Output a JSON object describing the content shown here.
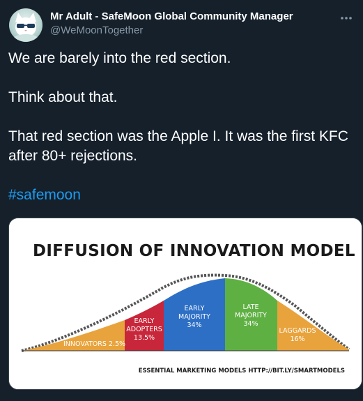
{
  "tweet": {
    "display_name": "Mr Adult - SafeMoon Global Community Manager",
    "handle": "@WeMoonTogether",
    "text_lines": [
      "We are barely into the red section.",
      "Think about that.",
      "That red section was the Apple I. It was the first KFC after 80+ rejections."
    ],
    "hashtag": "#safemoon",
    "more_icon": "more-horizontal-icon"
  },
  "media": {
    "title": "DIFFUSION OF INNOVATION MODEL",
    "footer": "ESSENTIAL MARKETING MODELS HTTP://BIT.LY/SMARTMODELS",
    "segments": [
      {
        "name": "innovators",
        "label_lines": [
          "INNOVATORS 2.5%"
        ],
        "color": "#e8a33c"
      },
      {
        "name": "early-adopters",
        "label_lines": [
          "EARLY",
          "ADOPTERS",
          "13.5%"
        ],
        "color": "#c8263a"
      },
      {
        "name": "early-majority",
        "label_lines": [
          "EARLY",
          "MAJORITY",
          "34%"
        ],
        "color": "#2c6fc5"
      },
      {
        "name": "late-majority",
        "label_lines": [
          "LATE",
          "MAJORITY",
          "34%"
        ],
        "color": "#5fb043"
      },
      {
        "name": "laggards",
        "label_lines": [
          "LAGGARDS",
          "16%"
        ],
        "color": "#e8a33c"
      }
    ]
  },
  "colors": {
    "background": "#15202b",
    "text": "#ffffff",
    "secondary_text": "#8899a6",
    "link": "#1d9bf0"
  }
}
